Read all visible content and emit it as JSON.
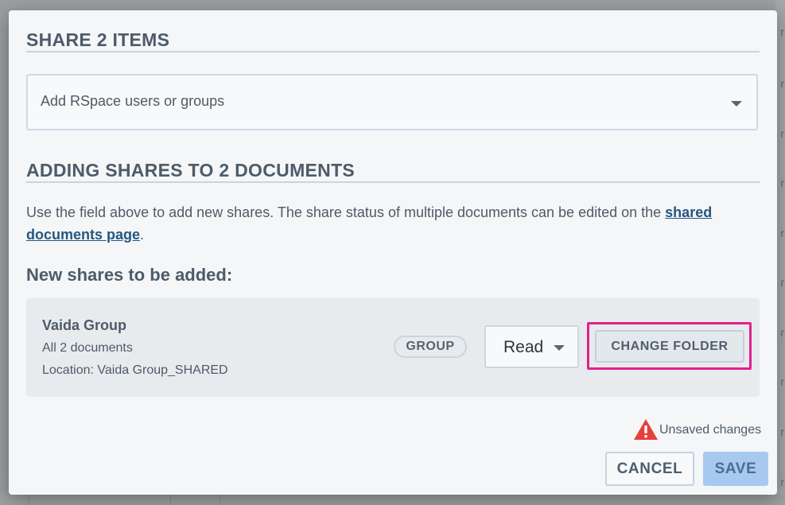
{
  "dialog": {
    "title": "SHARE 2 ITEMS",
    "search": {
      "placeholder": "Add RSpace users or groups"
    },
    "adding_title": "ADDING SHARES TO 2 DOCUMENTS",
    "help": {
      "text_before": "Use the field above to add new shares. The share status of multiple documents can be edited on the ",
      "link_text": "shared documents page",
      "text_after": "."
    },
    "new_shares_heading": "New shares to be added:",
    "share": {
      "name": "Vaida Group",
      "documents": "All 2 documents",
      "location": "Location: Vaida Group_SHARED",
      "type_badge": "GROUP",
      "permission": "Read",
      "change_folder_label": "CHANGE FOLDER"
    },
    "unsaved_text": "Unsaved changes",
    "cancel_label": "CANCEL",
    "save_label": "SAVE"
  },
  "colors": {
    "accent_highlight": "#e3208d",
    "warning": "#e5413b",
    "save_button": "#a7c9ef",
    "link": "#25577f"
  }
}
